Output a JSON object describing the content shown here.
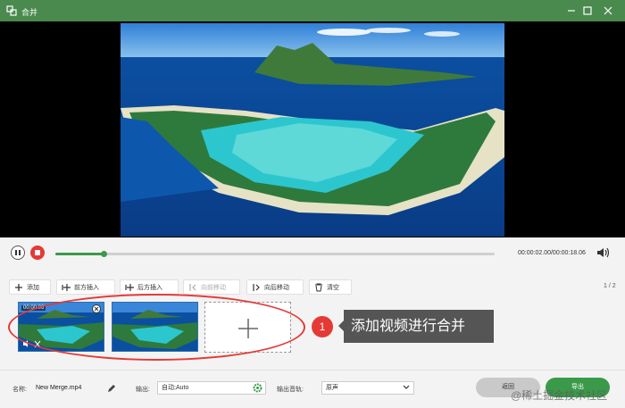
{
  "window": {
    "title": "合并",
    "accent_color": "#4a8a4e"
  },
  "player": {
    "time_display": "00:00:02.00/00:00:18.06",
    "progress_fraction": 0.11
  },
  "toolbar": {
    "add": "添加",
    "insert_before": "前方插入",
    "insert_after": "后方插入",
    "move_forward": "向前移动",
    "move_backward": "向后移动",
    "clear": "清空",
    "page_indicator": "1 / 2"
  },
  "clips": [
    {
      "badge": "00:00:06"
    },
    {
      "badge": ""
    }
  ],
  "annotation": {
    "step_number": "1",
    "tip": "添加视频进行合并"
  },
  "footer": {
    "name_label": "名称:",
    "name_value": "New Merge.mp4",
    "output_label": "输出:",
    "output_value": "自动;Auto",
    "audio_label": "输出音轨:",
    "audio_value": "原声",
    "back_button": "返回",
    "export_button": "导出",
    "watermark": "@稀土掘金技术社区"
  }
}
